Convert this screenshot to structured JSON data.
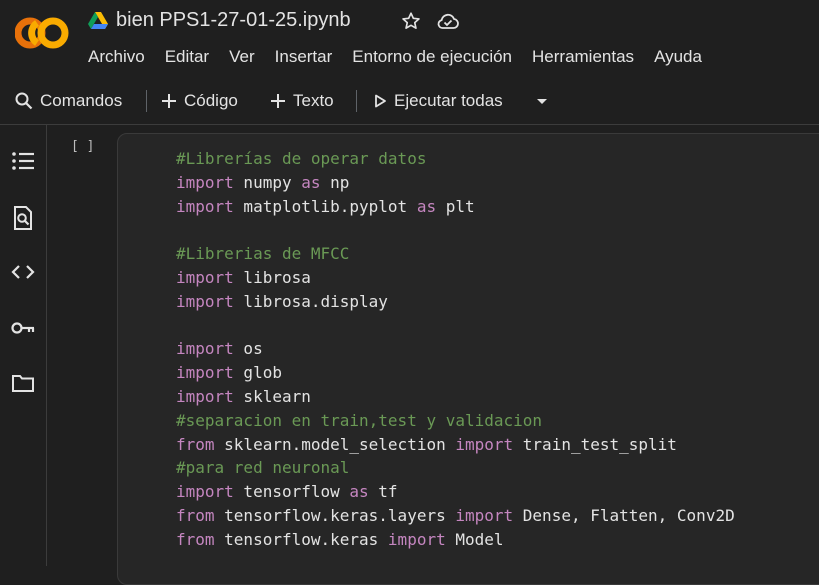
{
  "app": {
    "title": "bien PPS1-27-01-25.ipynb",
    "logo_text": "CO"
  },
  "menu": [
    {
      "label": "Archivo"
    },
    {
      "label": "Editar"
    },
    {
      "label": "Ver"
    },
    {
      "label": "Insertar"
    },
    {
      "label": "Entorno de ejecución"
    },
    {
      "label": "Herramientas"
    },
    {
      "label": "Ayuda"
    }
  ],
  "toolbar": {
    "commands_label": "Comandos",
    "code_label": "Código",
    "text_label": "Texto",
    "run_all_label": "Ejecutar todas"
  },
  "sidebar": {
    "icons": [
      "toc-icon",
      "find-replace-icon",
      "code-snippets-icon",
      "secrets-key-icon",
      "files-folder-icon"
    ]
  },
  "cell": {
    "exec_indicator": "[ ]",
    "lines": [
      [
        {
          "t": "#Librerías de operar datos",
          "c": "cm"
        }
      ],
      [
        {
          "t": "import",
          "c": "kw"
        },
        {
          "t": " numpy ",
          "c": "tx"
        },
        {
          "t": "as",
          "c": "kw"
        },
        {
          "t": " np",
          "c": "tx"
        }
      ],
      [
        {
          "t": "import",
          "c": "kw"
        },
        {
          "t": " matplotlib.pyplot ",
          "c": "tx"
        },
        {
          "t": "as",
          "c": "kw"
        },
        {
          "t": " plt",
          "c": "tx"
        }
      ],
      [],
      [
        {
          "t": "#Librerias de MFCC",
          "c": "cm"
        }
      ],
      [
        {
          "t": "import",
          "c": "kw"
        },
        {
          "t": " librosa",
          "c": "tx"
        }
      ],
      [
        {
          "t": "import",
          "c": "kw"
        },
        {
          "t": " librosa.display",
          "c": "tx"
        }
      ],
      [],
      [
        {
          "t": "import",
          "c": "kw"
        },
        {
          "t": " os",
          "c": "tx"
        }
      ],
      [
        {
          "t": "import",
          "c": "kw"
        },
        {
          "t": " glob",
          "c": "tx"
        }
      ],
      [
        {
          "t": "import",
          "c": "kw"
        },
        {
          "t": " sklearn",
          "c": "tx"
        }
      ],
      [
        {
          "t": "#separacion en train,test y validacion",
          "c": "cm"
        }
      ],
      [
        {
          "t": "from",
          "c": "kw"
        },
        {
          "t": " sklearn.model_selection ",
          "c": "tx"
        },
        {
          "t": "import",
          "c": "kw"
        },
        {
          "t": " train_test_split",
          "c": "tx"
        }
      ],
      [
        {
          "t": "#para red neuronal",
          "c": "cm"
        }
      ],
      [
        {
          "t": "import",
          "c": "kw"
        },
        {
          "t": " tensorflow ",
          "c": "tx"
        },
        {
          "t": "as",
          "c": "kw"
        },
        {
          "t": " tf",
          "c": "tx"
        }
      ],
      [
        {
          "t": "from",
          "c": "kw"
        },
        {
          "t": " tensorflow.keras.layers ",
          "c": "tx"
        },
        {
          "t": "import",
          "c": "kw"
        },
        {
          "t": " Dense, Flatten, Conv2D",
          "c": "tx"
        }
      ],
      [
        {
          "t": "from",
          "c": "kw"
        },
        {
          "t": " tensorflow.keras ",
          "c": "tx"
        },
        {
          "t": "import",
          "c": "kw"
        },
        {
          "t": " Model",
          "c": "tx"
        }
      ]
    ]
  },
  "colors": {
    "background": "#1f1f1f",
    "keyword": "#c586c0",
    "comment": "#6a9955",
    "text": "#e3e3e3",
    "logo_orange": "#f9ab00",
    "logo_dark_orange": "#e8710a"
  }
}
